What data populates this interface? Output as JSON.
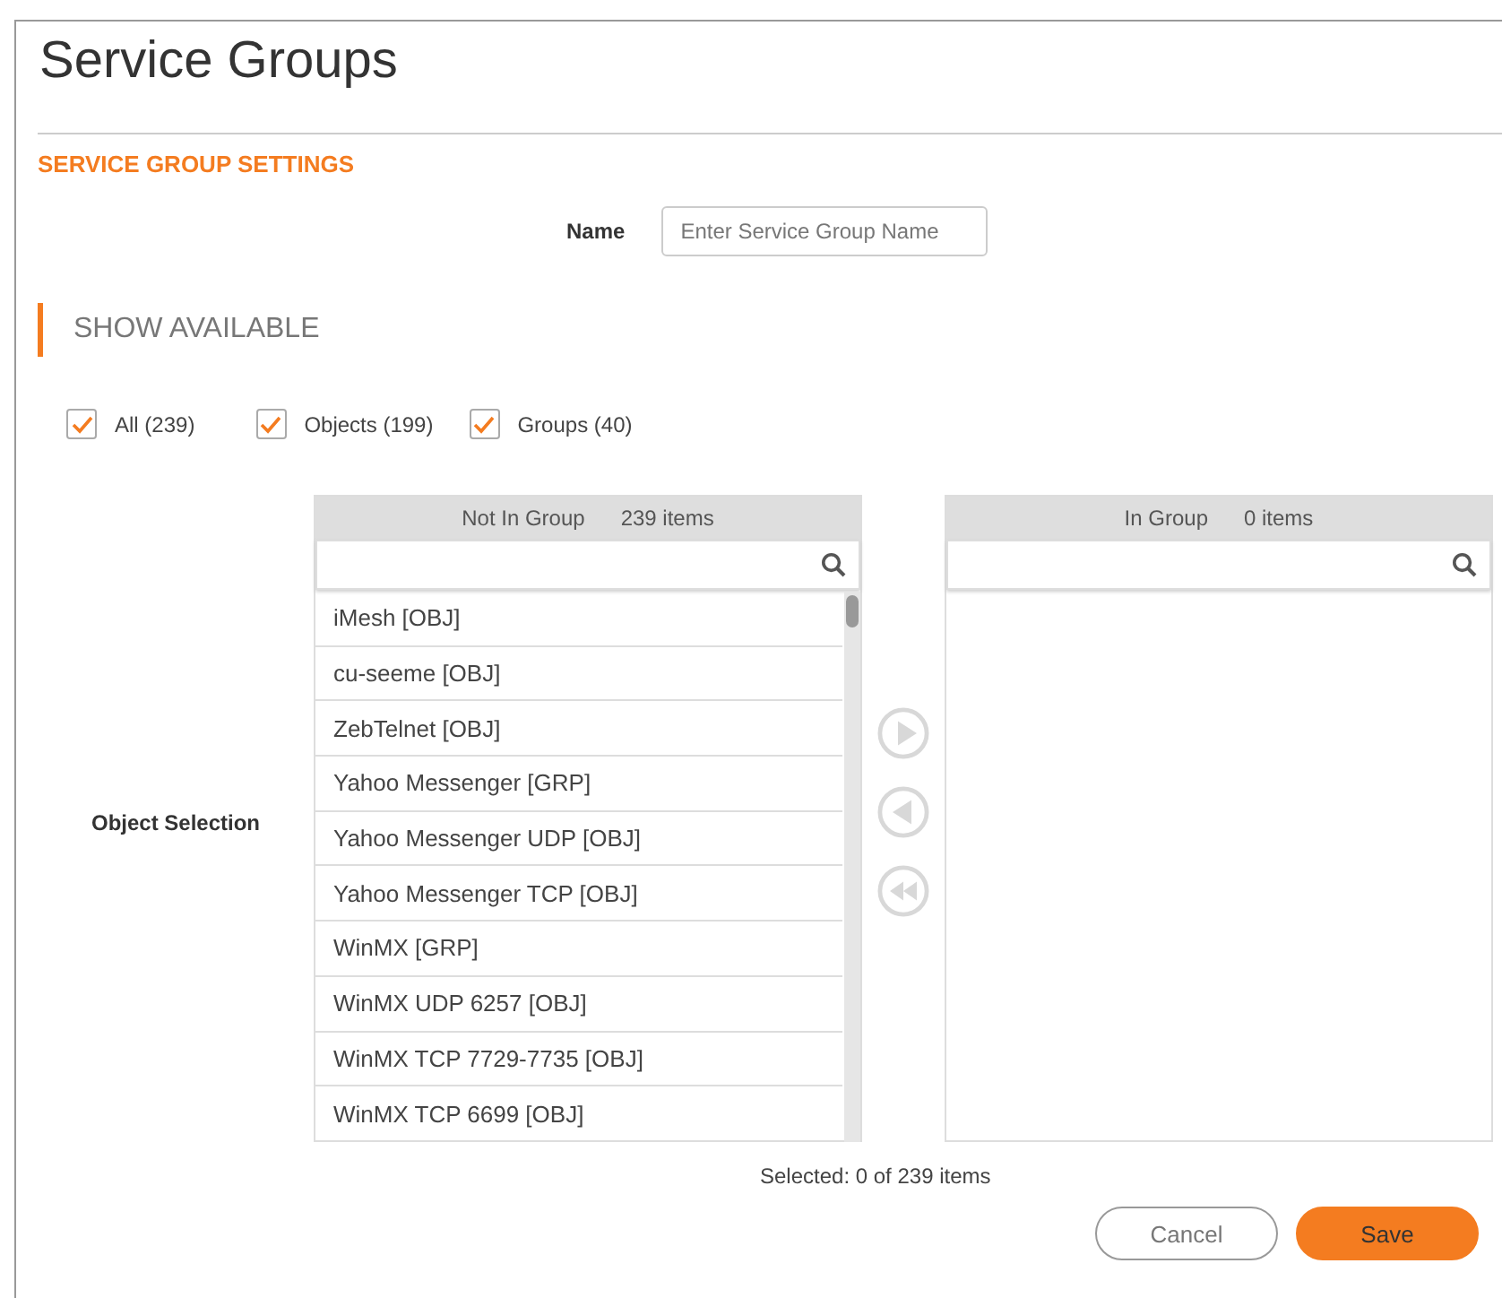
{
  "page": {
    "title": "Service Groups"
  },
  "section": {
    "title": "SERVICE GROUP SETTINGS"
  },
  "name_field": {
    "label": "Name",
    "placeholder": "Enter Service Group Name"
  },
  "show_available": {
    "title": "SHOW AVAILABLE",
    "filters": [
      {
        "label": "All (239)",
        "checked": true
      },
      {
        "label": "Objects (199)",
        "checked": true
      },
      {
        "label": "Groups (40)",
        "checked": true
      }
    ]
  },
  "object_selection": {
    "label": "Object Selection",
    "available": {
      "title": "Not In Group",
      "count": "239 items",
      "items": [
        "iMesh [OBJ]",
        "cu-seeme [OBJ]",
        "ZebTelnet [OBJ]",
        "Yahoo Messenger [GRP]",
        "Yahoo Messenger UDP [OBJ]",
        "Yahoo Messenger TCP [OBJ]",
        "WinMX [GRP]",
        "WinMX UDP 6257 [OBJ]",
        "WinMX TCP 7729-7735 [OBJ]",
        "WinMX TCP 6699 [OBJ]"
      ]
    },
    "members": {
      "title": "In Group",
      "count": "0 items"
    },
    "move_buttons": [
      {
        "kind": "add"
      },
      {
        "kind": "remove"
      },
      {
        "kind": "remove_all"
      }
    ],
    "selected_text": "Selected: 0 of 239 items"
  },
  "buttons": [
    {
      "label": "Cancel",
      "kind": "secondary"
    },
    {
      "label": "Save",
      "kind": "primary"
    }
  ]
}
